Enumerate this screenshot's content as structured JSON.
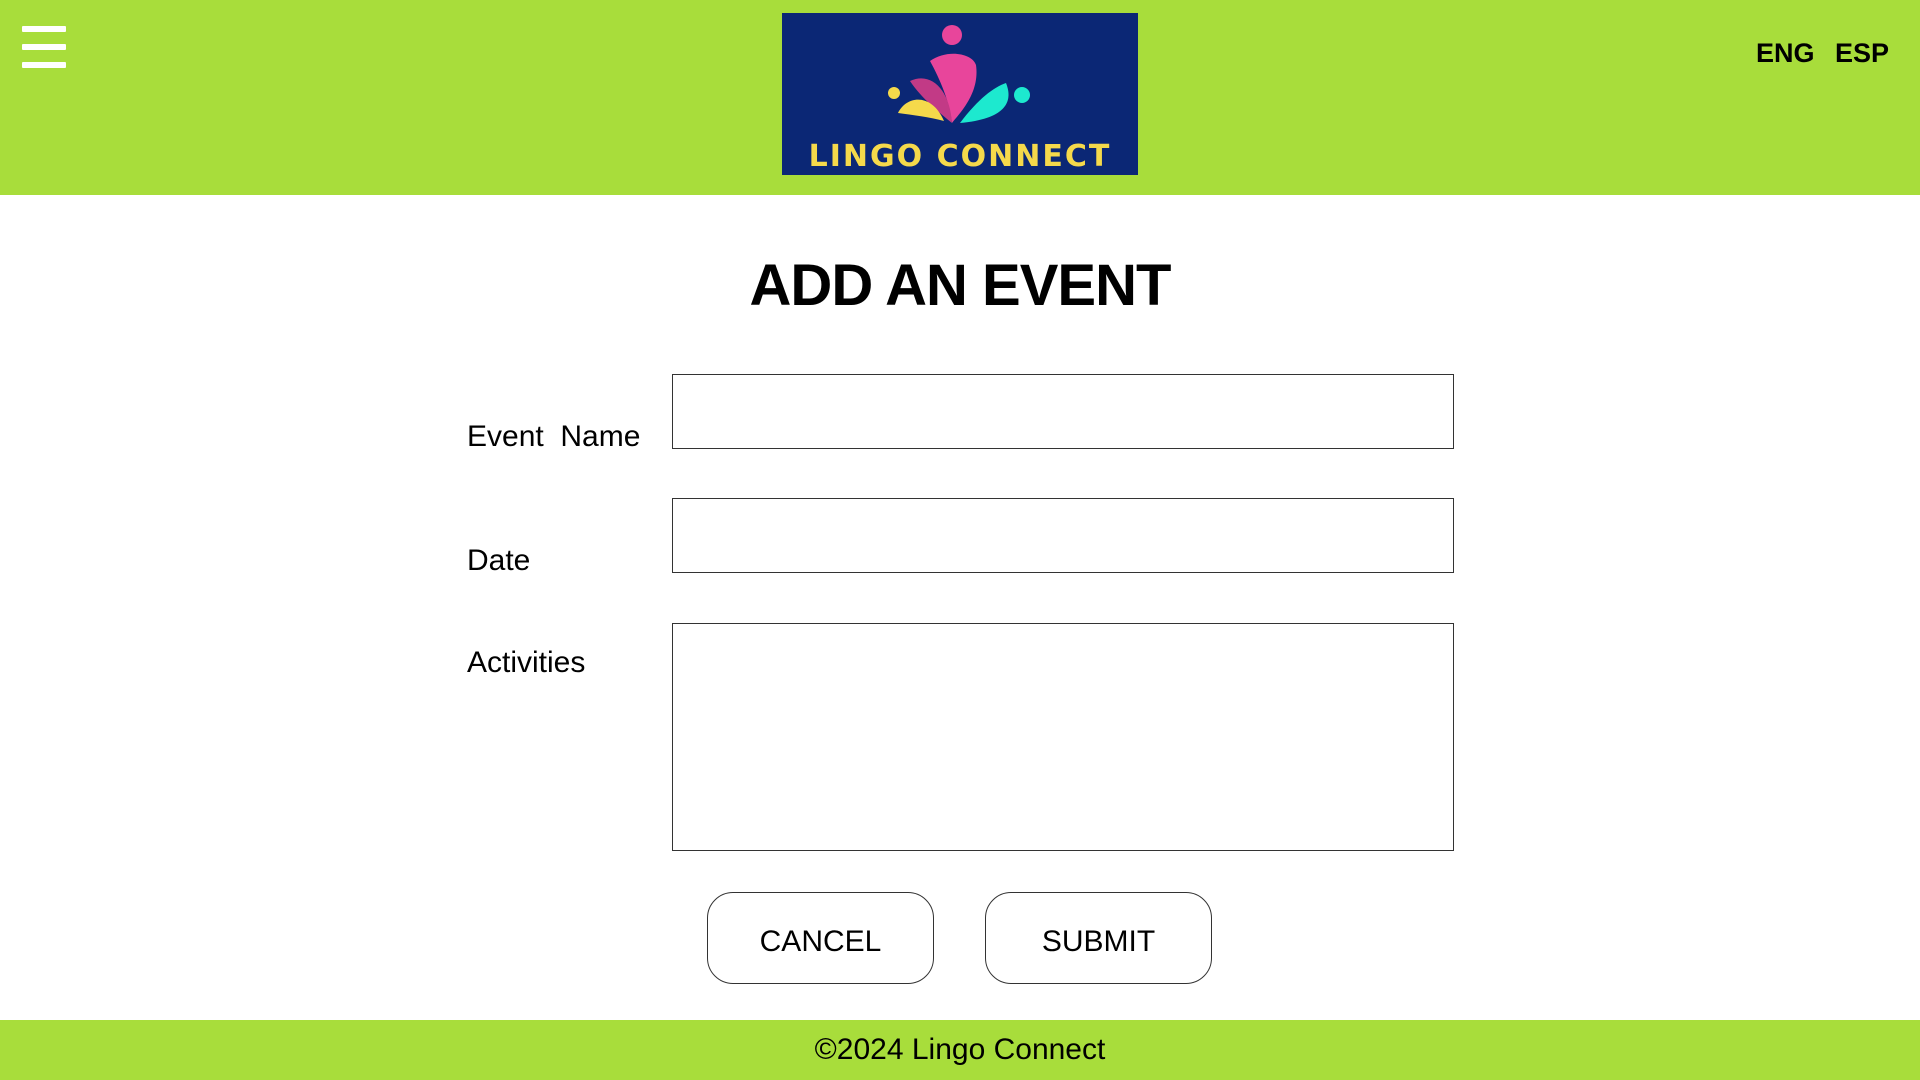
{
  "header": {
    "menu_icon": "hamburger-menu-icon",
    "logo_text": "LINGO CONNECT",
    "languages": [
      "ENG",
      "ESP"
    ],
    "colors": {
      "bar": "#a8dd3b",
      "logo_bg": "#0b2775",
      "logo_text": "#f5d94b",
      "accent_pink": "#e8459b",
      "accent_yellow": "#f5d94b",
      "accent_teal": "#1de9cf"
    }
  },
  "main": {
    "title": "ADD AN EVENT",
    "fields": {
      "event_name": {
        "label": "Event  Name",
        "value": ""
      },
      "date": {
        "label": "Date",
        "value": ""
      },
      "activities": {
        "label": "Activities",
        "value": ""
      }
    },
    "buttons": {
      "cancel": "CANCEL",
      "submit": "SUBMIT"
    }
  },
  "footer": {
    "text": "©2024 Lingo Connect"
  }
}
